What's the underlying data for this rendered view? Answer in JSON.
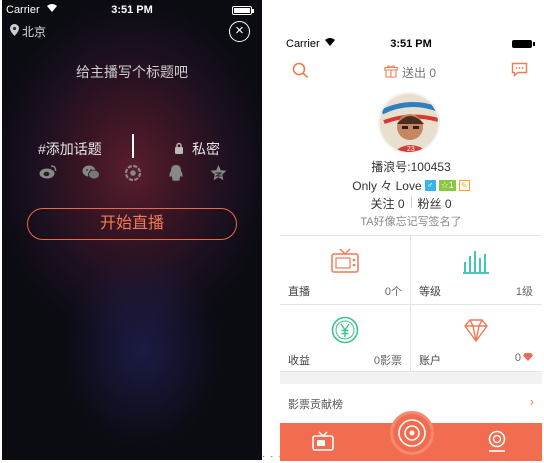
{
  "left_screen": {
    "status": {
      "carrier": "Carrier",
      "time": "3:51 PM"
    },
    "location": "北京",
    "title_prompt": "给主播写个标题吧",
    "topic": "#添加话题",
    "private_label": "私密",
    "share_icons": [
      "weibo-icon",
      "wechat-icon",
      "moments-icon",
      "qq-icon",
      "qzone-icon"
    ],
    "start_button": "开始直播",
    "close_icon": "close-icon"
  },
  "separator_dots": "· · ·",
  "right_screen": {
    "status": {
      "carrier": "Carrier",
      "time": "3:51 PM"
    },
    "nav": {
      "sent_label": "送出 0"
    },
    "profile": {
      "bolang_id": "播浪号:100453",
      "name": "Only 々 Love",
      "sex_badge": "♂",
      "level_badge": "☆1",
      "following": "关注 0",
      "fans": "粉丝 0",
      "signature": "TA好像忘记写签名了"
    },
    "stats": [
      {
        "label": "直播",
        "value": "0个",
        "icon": "tv-icon",
        "color": "#f07a55"
      },
      {
        "label": "等级",
        "value": "1级",
        "icon": "bars-icon",
        "color": "#2fc0b0"
      },
      {
        "label": "收益",
        "value": "0影票",
        "icon": "yen-coin-icon",
        "color": "#3cc38a"
      },
      {
        "label": "账户",
        "value": "0",
        "icon": "diamond-icon",
        "color": "#f07a55"
      }
    ],
    "rank_label": "影票贡献榜",
    "accent": "#f26d4f"
  }
}
